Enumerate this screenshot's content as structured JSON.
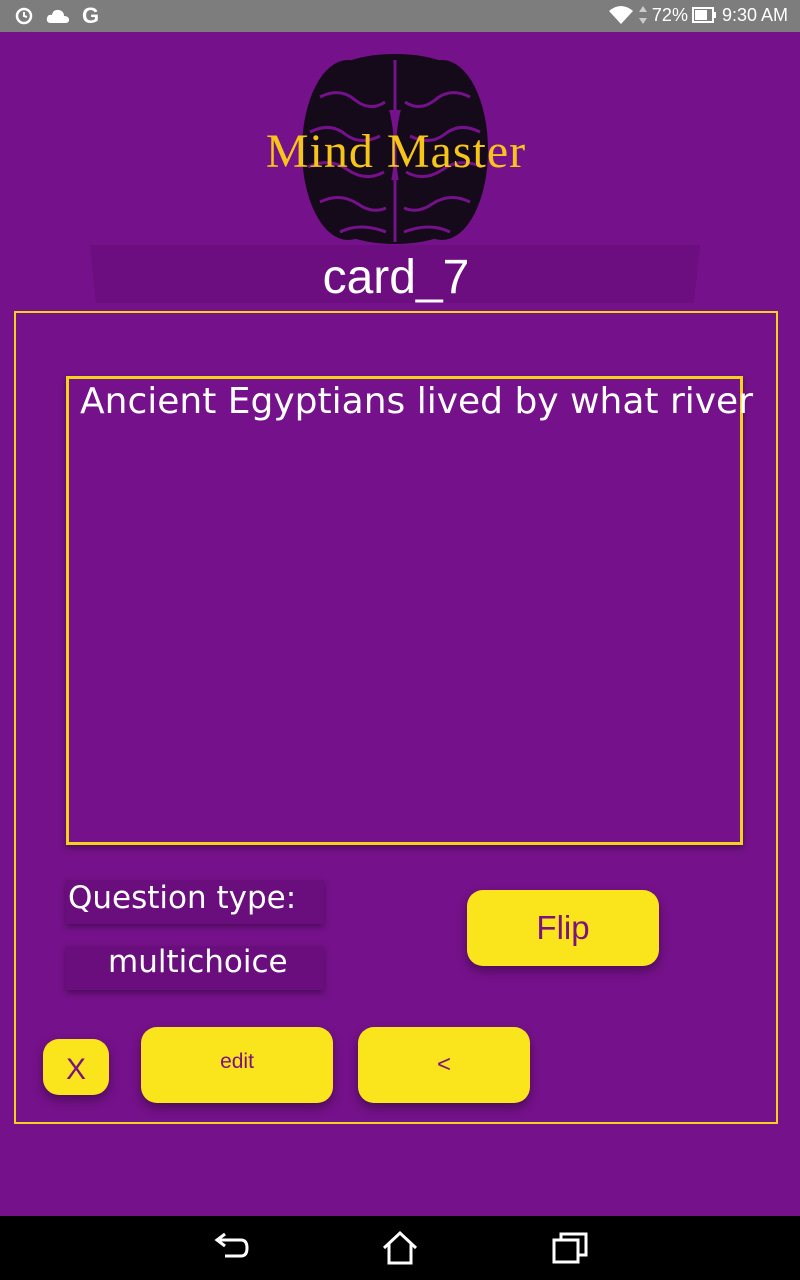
{
  "status_bar": {
    "battery": "72%",
    "time": "9:30 AM",
    "icons": [
      "sync-icon",
      "cloud-icon",
      "google-icon",
      "wifi-icon",
      "data-arrows-icon",
      "battery-icon"
    ]
  },
  "header": {
    "app_title": "Mind Master",
    "logo_icon": "brain-icon",
    "card_name": "card_7"
  },
  "card": {
    "question": "Ancient Egyptians lived by what river",
    "question_type_label": "Question type:",
    "question_type_value": "multichoice"
  },
  "buttons": {
    "flip": "Flip",
    "close": "X",
    "edit": "edit",
    "back": "<"
  },
  "nav_bar": {
    "icons": [
      "back-icon",
      "home-icon",
      "recents-icon"
    ]
  },
  "colors": {
    "background": "#75118a",
    "accent_yellow": "#fae51d",
    "title_gold": "#f7c519",
    "button_text": "#7b137f"
  }
}
